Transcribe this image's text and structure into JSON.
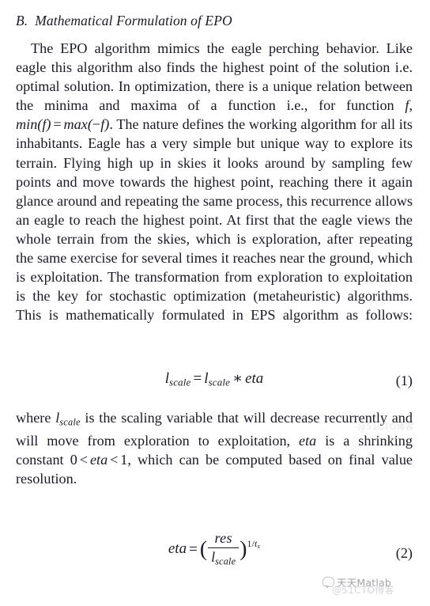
{
  "document": {
    "section_heading": "B.  Mathematical Formulation of EPO",
    "paragraph_1": {
      "part_1": "The EPO algorithm mimics the eagle perching behavior. Like eagle this algorithm also finds the highest point of the solution i.e. optimal solution. In optimization, there is a unique relation between the minima and maxima of a function i.e., for function ",
      "math_f": "f",
      "math_comma": ", ",
      "math_min": "min",
      "math_open1": "(",
      "math_f2": "f",
      "math_close1": ")",
      "math_eq": "=",
      "math_max": "max",
      "math_open2": "(",
      "math_minus": "−",
      "math_f3": "f",
      "math_close2": ")",
      "part_2": ". The nature defines the working algorithm for all its inhabitants. Eagle has a very simple but unique way to explore its terrain. Flying high up in skies it looks around by sampling few points and move towards the highest point, reaching there it again glance around and repeating the same process, this recurrence allows an eagle to reach the highest point. At first that the eagle views the whole terrain from the skies, which is exploration, after repeating the same exercise for several times it reaches near the ground, which is exploitation. The transformation from exploration to exploitation is the key for stochastic optimization (metaheuristic) algorithms. This is mathematically formulated in EPS algorithm as follows:"
    },
    "equation_1": {
      "lhs_var": "l",
      "lhs_sub": "scale",
      "equals": "=",
      "rhs_var": "l",
      "rhs_sub": "scale",
      "times": "∗",
      "rhs_eta": "eta",
      "number": "(1)"
    },
    "paragraph_2": {
      "part_1": "where ",
      "var_l": "l",
      "var_l_sub": "scale",
      "part_2": " is the scaling variable that will decrease recurrently and will move from exploration to exploitation, ",
      "var_eta_1": "eta",
      "part_3": " is a shrinking constant ",
      "bound_low": "0",
      "lt_1": "<",
      "var_eta_2": "eta",
      "lt_2": "<",
      "bound_high": "1",
      "part_4": ", which can be computed based on final value resolution."
    },
    "equation_2": {
      "lhs_eta": "eta",
      "equals": "=",
      "open_paren": "(",
      "numerator": "res",
      "denominator_var": "l",
      "denominator_sub": "scale",
      "close_paren": ")",
      "exponent_one": "1",
      "exponent_slash": "/",
      "exponent_t": "t",
      "exponent_sub": "s",
      "number": "(2)"
    }
  },
  "watermarks": {
    "matlab_text": "天天Matlab",
    "cto_text": "@51CTO博客",
    "cto_text_upper": "@51CTO博客"
  }
}
